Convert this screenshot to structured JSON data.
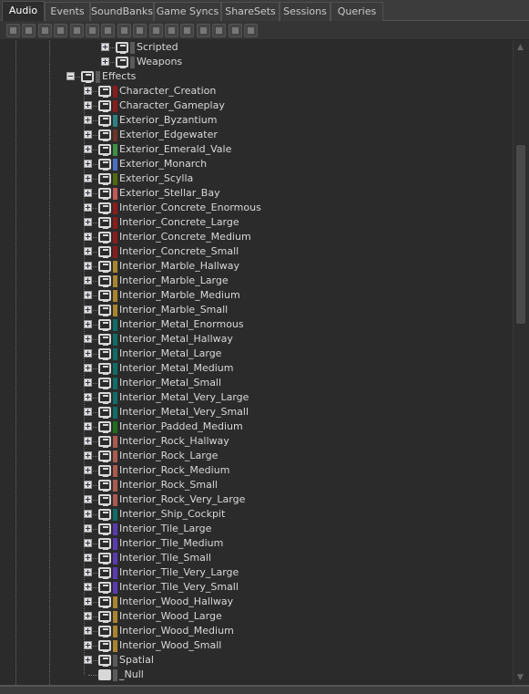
{
  "tabs": [
    {
      "label": "Audio",
      "active": true
    },
    {
      "label": "Events"
    },
    {
      "label": "SoundBanks"
    },
    {
      "label": "Game Syncs"
    },
    {
      "label": "ShareSets"
    },
    {
      "label": "Sessions"
    },
    {
      "label": "Queries"
    }
  ],
  "toolbar": [
    "work-unit-icon",
    "folder-icon",
    "virtual-folder-icon",
    "actor-mixer-icon",
    "random-container-icon",
    "sequence-container-icon",
    "switch-container-icon",
    "blend-container-icon",
    "sound-icon",
    "music-icon",
    "bus-icon",
    "aux-bus-icon",
    "motion-icon",
    "music-segment-icon",
    "music-track-icon",
    "music-switch-icon"
  ],
  "tree": {
    "top_items": [
      {
        "label": "Scripted",
        "color": "#5a5a5a"
      },
      {
        "label": "Weapons",
        "color": "#5a5a5a"
      }
    ],
    "parent": {
      "label": "Effects",
      "color": "#5a5a5a",
      "expanded": true
    },
    "children": [
      {
        "label": "Character_Creation",
        "color": "#8b1c1c"
      },
      {
        "label": "Character_Gameplay",
        "color": "#8b1c1c"
      },
      {
        "label": "Exterior_Byzantium",
        "color": "#2f8080"
      },
      {
        "label": "Exterior_Edgewater",
        "color": "#6b3428"
      },
      {
        "label": "Exterior_Emerald_Vale",
        "color": "#3e8f46"
      },
      {
        "label": "Exterior_Monarch",
        "color": "#4a6fbf"
      },
      {
        "label": "Exterior_Scylla",
        "color": "#4f6a10"
      },
      {
        "label": "Exterior_Stellar_Bay",
        "color": "#c05858"
      },
      {
        "label": "Interior_Concrete_Enormous",
        "color": "#8b1c1c"
      },
      {
        "label": "Interior_Concrete_Large",
        "color": "#8b1c1c"
      },
      {
        "label": "Interior_Concrete_Medium",
        "color": "#8b1c1c"
      },
      {
        "label": "Interior_Concrete_Small",
        "color": "#8b1c1c"
      },
      {
        "label": "Interior_Marble_Hallway",
        "color": "#a88430"
      },
      {
        "label": "Interior_Marble_Large",
        "color": "#a88430"
      },
      {
        "label": "Interior_Marble_Medium",
        "color": "#a88430"
      },
      {
        "label": "Interior_Marble_Small",
        "color": "#a88430"
      },
      {
        "label": "Interior_Metal_Enormous",
        "color": "#116b66"
      },
      {
        "label": "Interior_Metal_Hallway",
        "color": "#116b66"
      },
      {
        "label": "Interior_Metal_Large",
        "color": "#116b66"
      },
      {
        "label": "Interior_Metal_Medium",
        "color": "#116b66"
      },
      {
        "label": "Interior_Metal_Small",
        "color": "#116b66"
      },
      {
        "label": "Interior_Metal_Very_Large",
        "color": "#116b66"
      },
      {
        "label": "Interior_Metal_Very_Small",
        "color": "#116b66"
      },
      {
        "label": "Interior_Padded_Medium",
        "color": "#1f6e1c"
      },
      {
        "label": "Interior_Rock_Hallway",
        "color": "#a85a50"
      },
      {
        "label": "Interior_Rock_Large",
        "color": "#a85a50"
      },
      {
        "label": "Interior_Rock_Medium",
        "color": "#a85a50"
      },
      {
        "label": "Interior_Rock_Small",
        "color": "#a85a50"
      },
      {
        "label": "Interior_Rock_Very_Large",
        "color": "#a85a50"
      },
      {
        "label": "Interior_Ship_Cockpit",
        "color": "#116b66"
      },
      {
        "label": "Interior_Tile_Large",
        "color": "#5a3ab0"
      },
      {
        "label": "Interior_Tile_Medium",
        "color": "#5a3ab0"
      },
      {
        "label": "Interior_Tile_Small",
        "color": "#5a3ab0"
      },
      {
        "label": "Interior_Tile_Very_Large",
        "color": "#5a3ab0"
      },
      {
        "label": "Interior_Tile_Very_Small",
        "color": "#5a3ab0"
      },
      {
        "label": "Interior_Wood_Hallway",
        "color": "#a88430"
      },
      {
        "label": "Interior_Wood_Large",
        "color": "#a88430"
      },
      {
        "label": "Interior_Wood_Medium",
        "color": "#a88430"
      },
      {
        "label": "Interior_Wood_Small",
        "color": "#a88430"
      },
      {
        "label": "Spatial",
        "color": "#5a5a5a"
      },
      {
        "label": "_Null",
        "color": "#5a5a5a",
        "leaf": true
      }
    ]
  }
}
